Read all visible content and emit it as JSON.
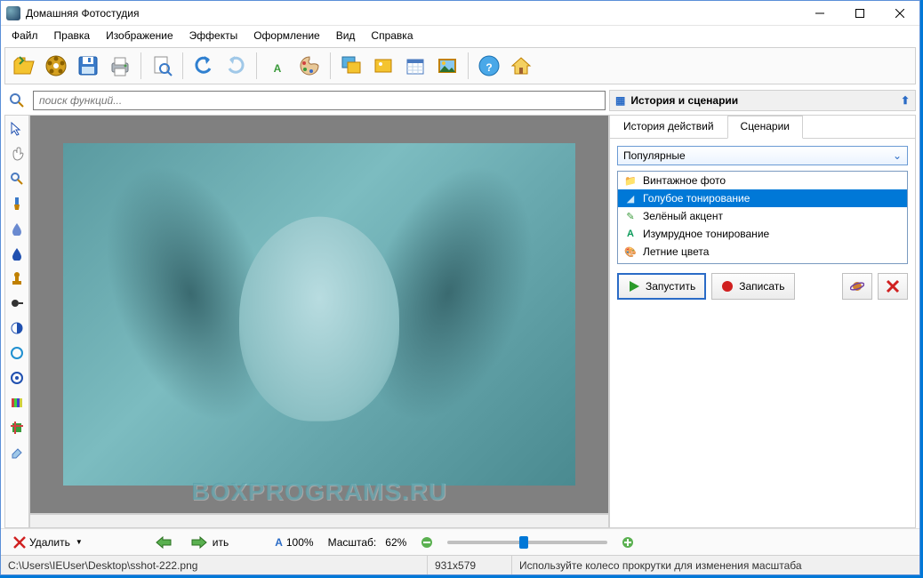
{
  "title": "Домашняя Фотостудия",
  "menu": [
    "Файл",
    "Правка",
    "Изображение",
    "Эффекты",
    "Оформление",
    "Вид",
    "Справка"
  ],
  "toolbar_icons": [
    "open-folder",
    "wheel",
    "save",
    "print",
    "page-preview",
    "undo",
    "redo",
    "text",
    "palette",
    "images",
    "image",
    "calendar",
    "picture",
    "help",
    "home"
  ],
  "search": {
    "placeholder": "поиск функций..."
  },
  "right_panel": {
    "title": "История и сценарии",
    "tabs": [
      "История действий",
      "Сценарии"
    ],
    "active_tab": 1,
    "dropdown": "Популярные",
    "presets": [
      {
        "label": "Винтажное фото",
        "icon": "📁",
        "color": "#e0a030"
      },
      {
        "label": "Голубое тонирование",
        "icon": "◢",
        "color": "#8ac6e8",
        "selected": true
      },
      {
        "label": "Зелёный акцент",
        "icon": "✎",
        "color": "#3a9a3a"
      },
      {
        "label": "Изумрудное тонирование",
        "icon": "A",
        "color": "#0a9a5a"
      },
      {
        "label": "Летние цвета",
        "icon": "🎨",
        "color": "#d07030"
      }
    ],
    "actions": {
      "run": "Запустить",
      "record": "Записать"
    }
  },
  "tools": [
    "cursor",
    "hand",
    "zoom",
    "brush",
    "drop",
    "shape",
    "stamp",
    "dodge",
    "contrast",
    "circle",
    "ring",
    "gradient",
    "crop",
    "eraser"
  ],
  "bottom": {
    "delete": "Удалить",
    "fit_label": "ить",
    "zoom_a": "100%",
    "zoom_label": "Масштаб:",
    "zoom_value": "62%"
  },
  "status": {
    "path": "C:\\Users\\IEUser\\Desktop\\sshot-222.png",
    "dims": "931x579",
    "hint": "Используйте колесо прокрутки для изменения масштаба"
  },
  "watermark": "BOXPROGRAMS.RU"
}
